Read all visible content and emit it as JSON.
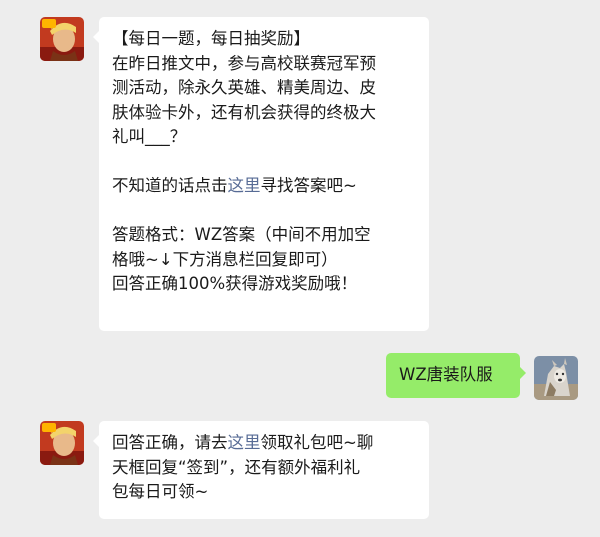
{
  "messages": [
    {
      "sender": "official-account",
      "avatar": "game-hero-avatar",
      "lines": [
        "【每日一题，每日抽奖励】",
        "在昨日推文中，参与高校联赛冠军预",
        "测活动，除永久英雄、精美周边、皮",
        "肤体验卡外，还有机会获得的终极大",
        "礼叫___？"
      ],
      "hint_prefix": "不知道的话点击",
      "hint_link": "这里",
      "hint_suffix": "寻找答案吧~",
      "format_lines": [
        "答题格式：WZ答案（中间不用加空",
        "格哦~↓下方消息栏回复即可）",
        "回答正确100%获得游戏奖励哦！"
      ]
    },
    {
      "sender": "user",
      "avatar": "user-wolf-avatar",
      "text": "WZ唐装队服"
    },
    {
      "sender": "official-account",
      "avatar": "game-hero-avatar",
      "prefix": "回答正确，请去",
      "link": "这里",
      "suffix": "领取礼包吧~聊",
      "lines": [
        "天框回复“签到”，还有额外福利礼",
        "包每日可领~"
      ]
    }
  ],
  "colors": {
    "background": "#ededed",
    "bubble_left": "#ffffff",
    "bubble_right": "#95ec69",
    "link": "#576b95"
  }
}
